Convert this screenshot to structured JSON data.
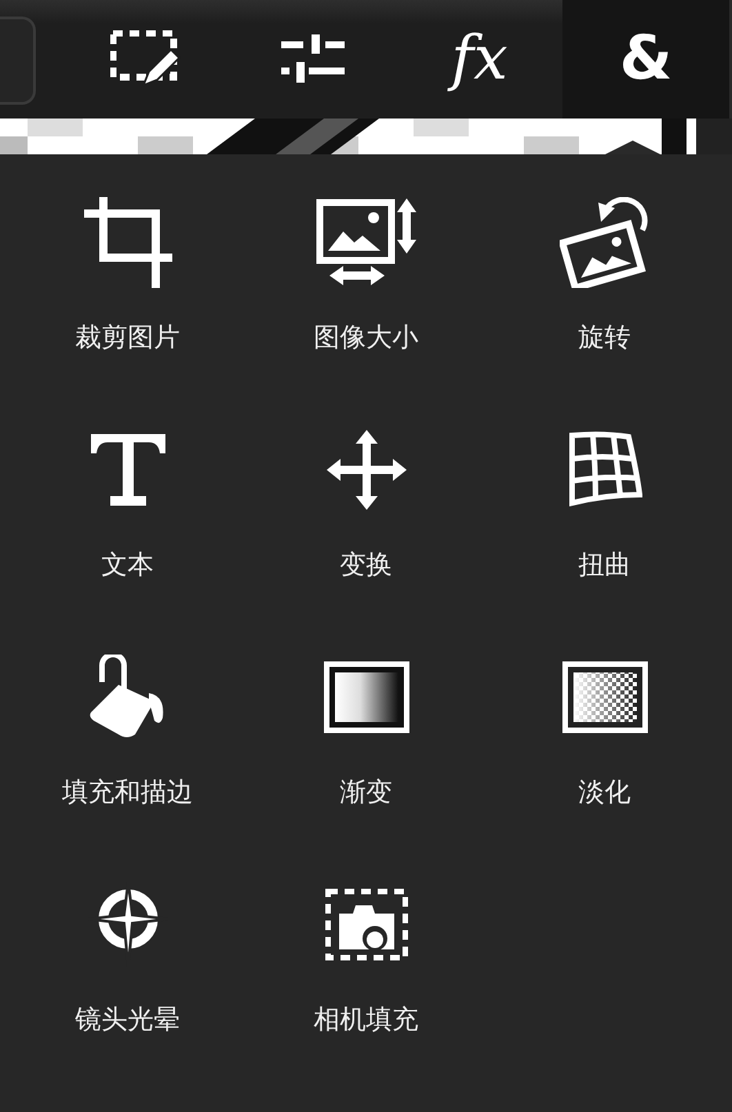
{
  "toolbar": {
    "tabs": [
      {
        "kind": "selection-edit",
        "selected": false
      },
      {
        "kind": "adjust",
        "selected": false
      },
      {
        "kind": "text",
        "label": "fx",
        "selected": false
      },
      {
        "kind": "text",
        "label": "&",
        "selected": true
      }
    ]
  },
  "tools": [
    {
      "kind": "crop",
      "label": "裁剪图片"
    },
    {
      "kind": "resize",
      "label": "图像大小"
    },
    {
      "kind": "rotate",
      "label": "旋转"
    },
    {
      "kind": "text",
      "label": "文本"
    },
    {
      "kind": "move",
      "label": "变换"
    },
    {
      "kind": "warp",
      "label": "扭曲"
    },
    {
      "kind": "fill",
      "label": "填充和描边"
    },
    {
      "kind": "gradient",
      "label": "渐变"
    },
    {
      "kind": "fade",
      "label": "淡化"
    },
    {
      "kind": "flare",
      "label": "镜头光晕"
    },
    {
      "kind": "camera",
      "label": "相机填充"
    }
  ]
}
